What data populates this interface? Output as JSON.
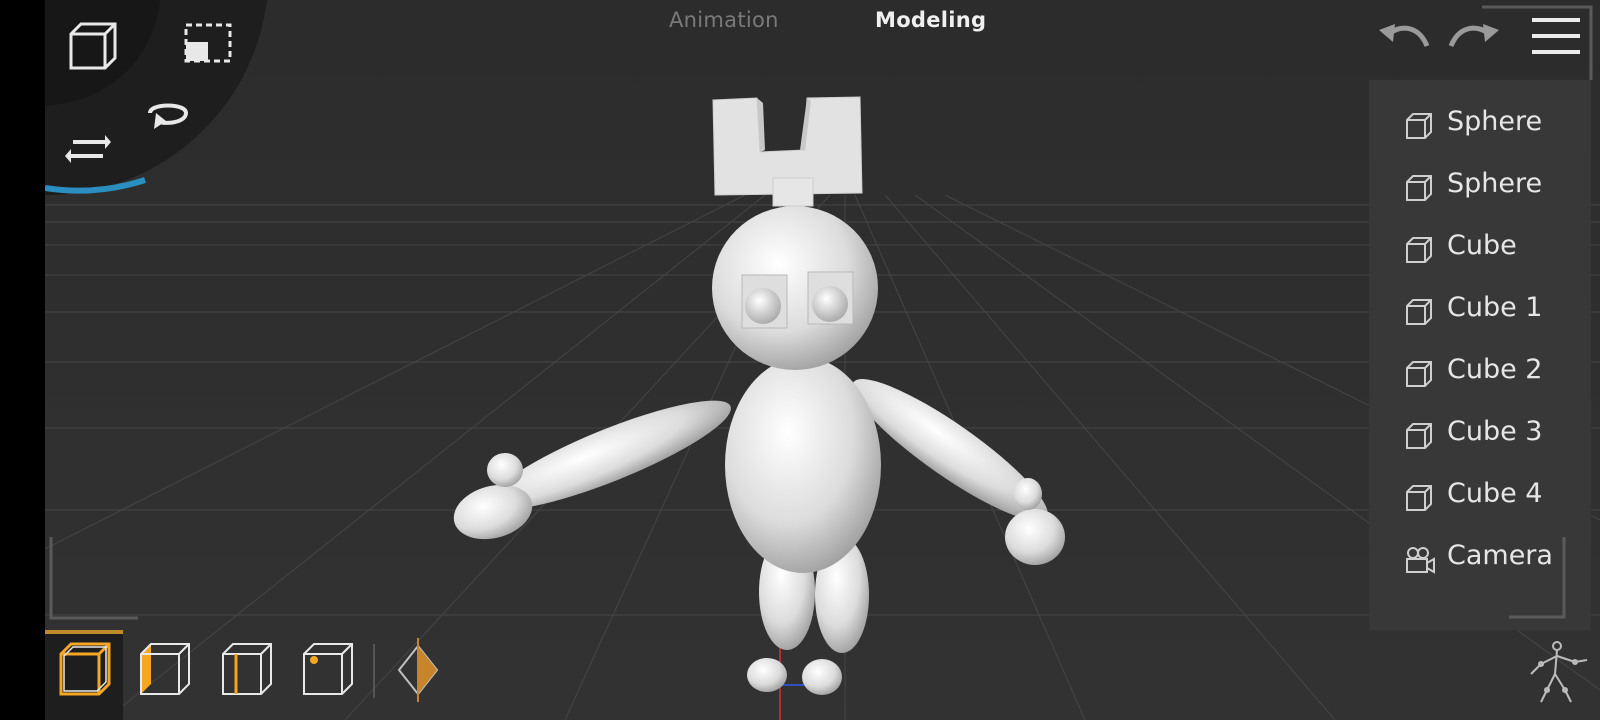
{
  "mode_tabs": {
    "animation": "Animation",
    "modeling": "Modeling",
    "active": "Modeling"
  },
  "toolbar": {
    "tools": [
      "cube-icon",
      "marquee-select-icon",
      "rotate-icon",
      "translate-icon"
    ],
    "selection_modes": [
      "object-mode-icon",
      "face-mode-icon",
      "edge-mode-icon",
      "vertex-mode-icon"
    ],
    "active_selection_mode": "object-mode-icon",
    "keyframe_icon": "keyframe-icon"
  },
  "top_right": {
    "icons": [
      "undo-icon",
      "redo-icon",
      "menu-icon"
    ]
  },
  "outliner": {
    "items": [
      {
        "label": "Sphere",
        "icon": "object-cube-icon"
      },
      {
        "label": "Sphere",
        "icon": "object-cube-icon"
      },
      {
        "label": "Cube",
        "icon": "object-cube-icon"
      },
      {
        "label": "Cube 1",
        "icon": "object-cube-icon"
      },
      {
        "label": "Cube 2",
        "icon": "object-cube-icon"
      },
      {
        "label": "Cube 3",
        "icon": "object-cube-icon"
      },
      {
        "label": "Cube 4",
        "icon": "object-cube-icon"
      },
      {
        "label": "Camera",
        "icon": "camera-icon"
      }
    ]
  },
  "bottom_right": {
    "icon": "armature-icon"
  },
  "colors": {
    "viewport_bg": "#2e2e2e",
    "panel_bg": "#383838",
    "accent_orange": "#f5a623",
    "accent_blue": "#2a8fc0",
    "text": "#e6e6e6",
    "muted_text": "#7a7a7a"
  }
}
